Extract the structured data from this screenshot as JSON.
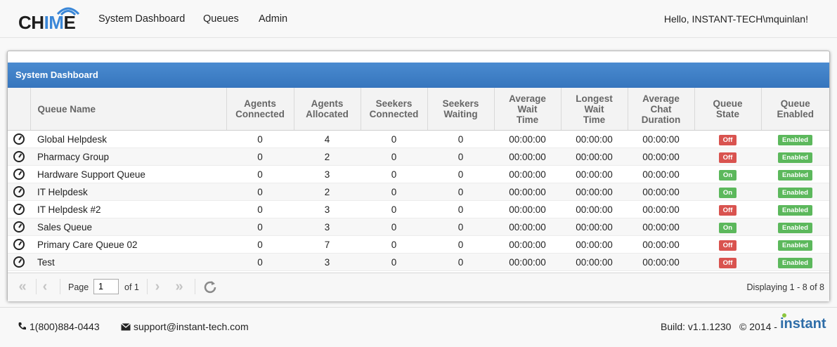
{
  "brand": {
    "name_prefix": "CH",
    "name_highlight": "IM",
    "name_suffix": "E"
  },
  "nav": {
    "dashboard": "System Dashboard",
    "queues": "Queues",
    "admin": "Admin"
  },
  "greeting": "Hello, INSTANT-TECH\\mquinlan!",
  "panel": {
    "title": "System Dashboard"
  },
  "table": {
    "headers": {
      "queue_name": "Queue Name",
      "agents_connected": [
        "Agents",
        "Connected"
      ],
      "agents_allocated": [
        "Agents",
        "Allocated"
      ],
      "seekers_connected": [
        "Seekers",
        "Connected"
      ],
      "seekers_waiting": [
        "Seekers",
        "Waiting"
      ],
      "avg_wait": [
        "Average",
        "Wait",
        "Time"
      ],
      "longest_wait": [
        "Longest",
        "Wait",
        "Time"
      ],
      "avg_chat": [
        "Average",
        "Chat",
        "Duration"
      ],
      "queue_state": [
        "Queue",
        "State"
      ],
      "queue_enabled": [
        "Queue",
        "Enabled"
      ]
    },
    "rows": [
      {
        "name": "Global Helpdesk",
        "agents_connected": "0",
        "agents_allocated": "4",
        "seekers_connected": "0",
        "seekers_waiting": "0",
        "avg_wait": "00:00:00",
        "longest_wait": "00:00:00",
        "avg_chat": "00:00:00",
        "state": "Off",
        "enabled": "Enabled"
      },
      {
        "name": "Pharmacy Group",
        "agents_connected": "0",
        "agents_allocated": "2",
        "seekers_connected": "0",
        "seekers_waiting": "0",
        "avg_wait": "00:00:00",
        "longest_wait": "00:00:00",
        "avg_chat": "00:00:00",
        "state": "Off",
        "enabled": "Enabled"
      },
      {
        "name": "Hardware Support Queue",
        "agents_connected": "0",
        "agents_allocated": "3",
        "seekers_connected": "0",
        "seekers_waiting": "0",
        "avg_wait": "00:00:00",
        "longest_wait": "00:00:00",
        "avg_chat": "00:00:00",
        "state": "On",
        "enabled": "Enabled"
      },
      {
        "name": "IT Helpdesk",
        "agents_connected": "0",
        "agents_allocated": "2",
        "seekers_connected": "0",
        "seekers_waiting": "0",
        "avg_wait": "00:00:00",
        "longest_wait": "00:00:00",
        "avg_chat": "00:00:00",
        "state": "On",
        "enabled": "Enabled"
      },
      {
        "name": "IT Helpdesk #2",
        "agents_connected": "0",
        "agents_allocated": "3",
        "seekers_connected": "0",
        "seekers_waiting": "0",
        "avg_wait": "00:00:00",
        "longest_wait": "00:00:00",
        "avg_chat": "00:00:00",
        "state": "Off",
        "enabled": "Enabled"
      },
      {
        "name": "Sales Queue",
        "agents_connected": "0",
        "agents_allocated": "3",
        "seekers_connected": "0",
        "seekers_waiting": "0",
        "avg_wait": "00:00:00",
        "longest_wait": "00:00:00",
        "avg_chat": "00:00:00",
        "state": "On",
        "enabled": "Enabled"
      },
      {
        "name": "Primary Care Queue 02",
        "agents_connected": "0",
        "agents_allocated": "7",
        "seekers_connected": "0",
        "seekers_waiting": "0",
        "avg_wait": "00:00:00",
        "longest_wait": "00:00:00",
        "avg_chat": "00:00:00",
        "state": "Off",
        "enabled": "Enabled"
      },
      {
        "name": "Test",
        "agents_connected": "0",
        "agents_allocated": "3",
        "seekers_connected": "0",
        "seekers_waiting": "0",
        "avg_wait": "00:00:00",
        "longest_wait": "00:00:00",
        "avg_chat": "00:00:00",
        "state": "Off",
        "enabled": "Enabled"
      }
    ]
  },
  "pager": {
    "page_label": "Page",
    "page_value": "1",
    "of_label": "of 1",
    "displaying": "Displaying 1 - 8 of 8"
  },
  "footer": {
    "phone": "1(800)884-0443",
    "email": "support@instant-tech.com",
    "build": "Build: v1.1.1230",
    "copyright": "© 2014 -",
    "company": "instant"
  },
  "colors": {
    "header_blue": "#3c7fc6",
    "off_red": "#d9534f",
    "on_green": "#5cb85c"
  }
}
